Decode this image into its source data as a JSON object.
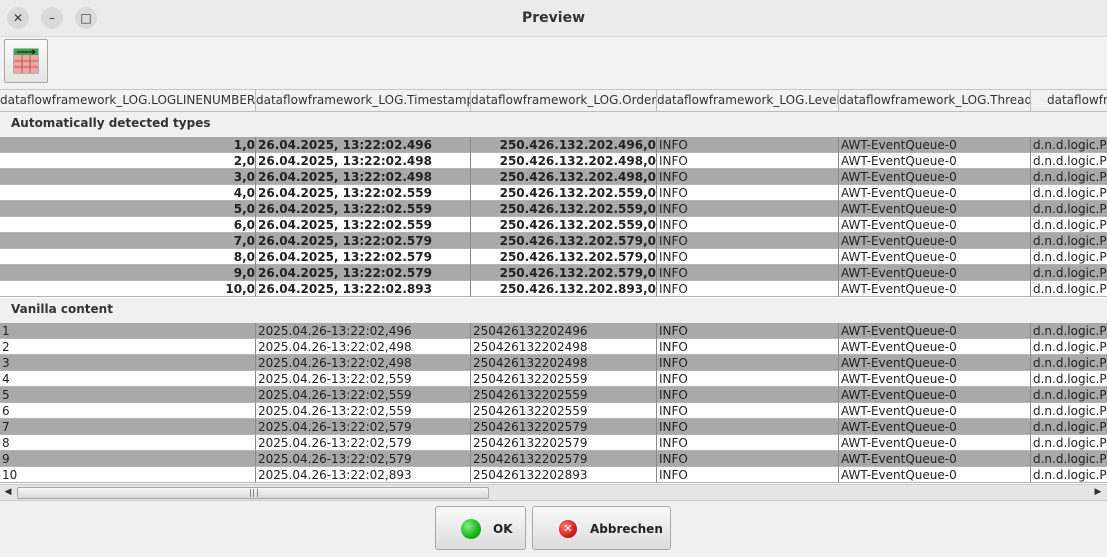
{
  "window": {
    "title": "Preview",
    "close_glyph": "✕",
    "minimize_glyph": "–",
    "maximize_glyph": "□"
  },
  "toolbar": {
    "icon": "table-icon"
  },
  "columns": [
    "dataflowframework_LOG.LOGLINENUMBER",
    "dataflowframework_LOG.Timestamp",
    "dataflowframework_LOG.Order",
    "dataflowframework_LOG.Level",
    "dataflowframework_LOG.Thread",
    "dataflowfr"
  ],
  "sections": [
    {
      "title": "Automatically detected types",
      "rows": [
        [
          "1,0",
          "26.04.2025, 13:22:02.496",
          "250.426.132.202.496,0",
          "INFO",
          "AWT-EventQueue-0",
          "d.n.d.logic.Pr"
        ],
        [
          "2,0",
          "26.04.2025, 13:22:02.498",
          "250.426.132.202.498,0",
          "INFO",
          "AWT-EventQueue-0",
          "d.n.d.logic.Pr"
        ],
        [
          "3,0",
          "26.04.2025, 13:22:02.498",
          "250.426.132.202.498,0",
          "INFO",
          "AWT-EventQueue-0",
          "d.n.d.logic.Pr"
        ],
        [
          "4,0",
          "26.04.2025, 13:22:02.559",
          "250.426.132.202.559,0",
          "INFO",
          "AWT-EventQueue-0",
          "d.n.d.logic.Pr"
        ],
        [
          "5,0",
          "26.04.2025, 13:22:02.559",
          "250.426.132.202.559,0",
          "INFO",
          "AWT-EventQueue-0",
          "d.n.d.logic.Pr"
        ],
        [
          "6,0",
          "26.04.2025, 13:22:02.559",
          "250.426.132.202.559,0",
          "INFO",
          "AWT-EventQueue-0",
          "d.n.d.logic.Pr"
        ],
        [
          "7,0",
          "26.04.2025, 13:22:02.579",
          "250.426.132.202.579,0",
          "INFO",
          "AWT-EventQueue-0",
          "d.n.d.logic.Pr"
        ],
        [
          "8,0",
          "26.04.2025, 13:22:02.579",
          "250.426.132.202.579,0",
          "INFO",
          "AWT-EventQueue-0",
          "d.n.d.logic.Pr"
        ],
        [
          "9,0",
          "26.04.2025, 13:22:02.579",
          "250.426.132.202.579,0",
          "INFO",
          "AWT-EventQueue-0",
          "d.n.d.logic.Pr"
        ],
        [
          "10,0",
          "26.04.2025, 13:22:02.893",
          "250.426.132.202.893,0",
          "INFO",
          "AWT-EventQueue-0",
          "d.n.d.logic.Pr"
        ]
      ]
    },
    {
      "title": "Vanilla content",
      "rows": [
        [
          "1",
          "2025.04.26-13:22:02,496",
          "250426132202496",
          "INFO",
          "AWT-EventQueue-0",
          "d.n.d.logic.Pr"
        ],
        [
          "2",
          "2025.04.26-13:22:02,498",
          "250426132202498",
          "INFO",
          "AWT-EventQueue-0",
          "d.n.d.logic.Pr"
        ],
        [
          "3",
          "2025.04.26-13:22:02,498",
          "250426132202498",
          "INFO",
          "AWT-EventQueue-0",
          "d.n.d.logic.Pr"
        ],
        [
          "4",
          "2025.04.26-13:22:02,559",
          "250426132202559",
          "INFO",
          "AWT-EventQueue-0",
          "d.n.d.logic.Pr"
        ],
        [
          "5",
          "2025.04.26-13:22:02,559",
          "250426132202559",
          "INFO",
          "AWT-EventQueue-0",
          "d.n.d.logic.Pr"
        ],
        [
          "6",
          "2025.04.26-13:22:02,559",
          "250426132202559",
          "INFO",
          "AWT-EventQueue-0",
          "d.n.d.logic.Pr"
        ],
        [
          "7",
          "2025.04.26-13:22:02,579",
          "250426132202579",
          "INFO",
          "AWT-EventQueue-0",
          "d.n.d.logic.Pr"
        ],
        [
          "8",
          "2025.04.26-13:22:02,579",
          "250426132202579",
          "INFO",
          "AWT-EventQueue-0",
          "d.n.d.logic.Pr"
        ],
        [
          "9",
          "2025.04.26-13:22:02,579",
          "250426132202579",
          "INFO",
          "AWT-EventQueue-0",
          "d.n.d.logic.Pr"
        ],
        [
          "10",
          "2025.04.26-13:22:02,893",
          "250426132202893",
          "INFO",
          "AWT-EventQueue-0",
          "d.n.d.logic.Pr"
        ]
      ]
    }
  ],
  "scrollbar": {
    "left_arrow": "◀",
    "right_arrow": "▶"
  },
  "buttons": {
    "ok": "OK",
    "cancel": "Abbrechen"
  },
  "colors": {
    "row_dark": "#a9a9a9",
    "row_light": "#ffffff",
    "ok_green": "#19b319",
    "cancel_red": "#d41d1d"
  }
}
